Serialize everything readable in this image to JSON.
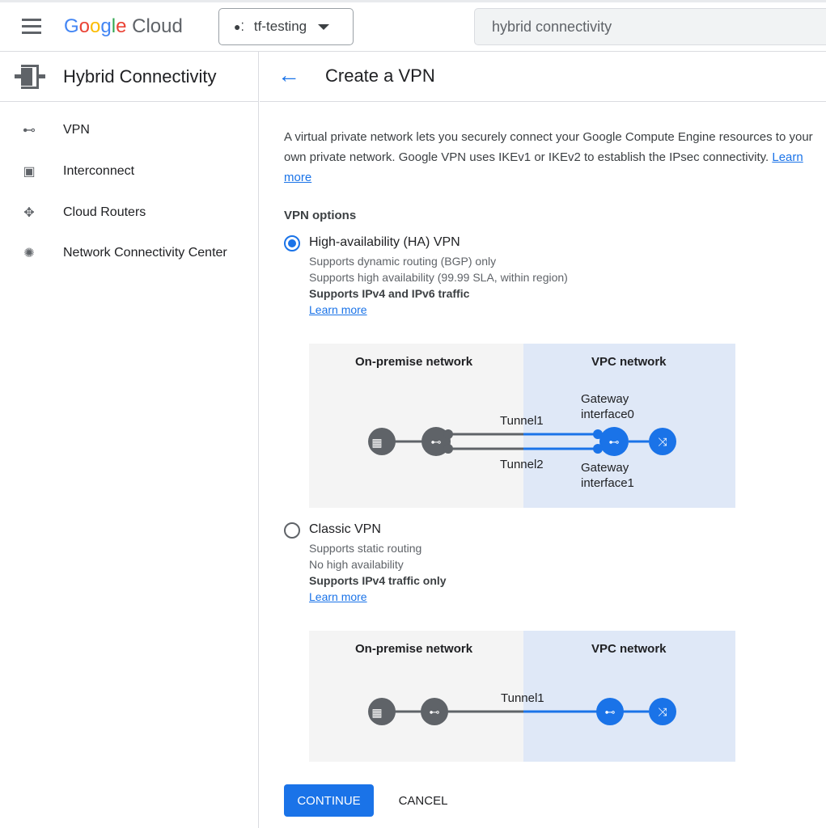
{
  "topbar": {
    "logo": "Google Cloud",
    "project": "tf-testing",
    "search_value": "hybrid connectivity"
  },
  "sidebar": {
    "title": "Hybrid Connectivity",
    "items": [
      {
        "label": "VPN"
      },
      {
        "label": "Interconnect"
      },
      {
        "label": "Cloud Routers"
      },
      {
        "label": "Network Connectivity Center"
      }
    ]
  },
  "main": {
    "title": "Create a VPN",
    "description": "A virtual private network lets you securely connect your Google Compute Engine resources to your own private network. Google VPN uses IKEv1 or IKEv2 to establish the IPsec connectivity.",
    "learn_more": "Learn more",
    "options_heading": "VPN options",
    "options": [
      {
        "label": "High-availability (HA) VPN",
        "selected": true,
        "lines": [
          "Supports dynamic routing (BGP) only",
          "Supports high availability (99.99 SLA, within region)"
        ],
        "bold": "Supports IPv4 and IPv6 traffic",
        "learn_more": "Learn more",
        "diagram": {
          "left": "On-premise network",
          "right": "VPC network",
          "tunnel1": "Tunnel1",
          "tunnel2": "Tunnel2",
          "gw0": "Gateway interface0",
          "gw1": "Gateway interface1"
        }
      },
      {
        "label": "Classic VPN",
        "selected": false,
        "lines": [
          "Supports static routing",
          "No high availability"
        ],
        "bold": "Supports IPv4 traffic only",
        "learn_more": "Learn more",
        "diagram": {
          "left": "On-premise network",
          "right": "VPC network",
          "tunnel1": "Tunnel1"
        }
      }
    ],
    "continue": "CONTINUE",
    "cancel": "CANCEL"
  },
  "colors": {
    "accent": "#1a73e8",
    "onprem_bg": "#f4f4f4",
    "vpc_bg": "#dfe8f7"
  }
}
